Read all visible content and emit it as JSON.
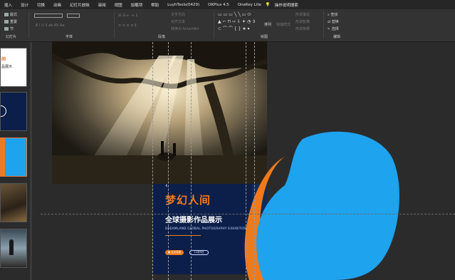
{
  "menu": [
    "插入",
    "设计",
    "切换",
    "动画",
    "幻灯片放映",
    "审阅",
    "视图",
    "加载项",
    "帮助",
    "LuyhTools(0429)",
    "OKPlus 4.5",
    "OneKey Lite",
    "操作说明搜索"
  ],
  "ribbon": {
    "slides_group": {
      "label": "幻灯片",
      "new_label": "版式",
      "reset_label": "重置",
      "section_label": "节"
    },
    "font_group": {
      "label": "字体"
    },
    "paragraph_group": {
      "label": "段落",
      "items": [
        "文字方向",
        "对齐文本",
        "转换为 SmartArt"
      ]
    },
    "drawing_group": {
      "label": "绘图",
      "arrange_label": "排列",
      "quick_styles_label": "快速样式",
      "fill_label": "形状填充",
      "outline_label": "形状轮廓",
      "effect_label": "形状效果"
    },
    "editing_group": {
      "label": "编辑",
      "find_label": "查找",
      "replace_label": "替换",
      "select_label": "选择"
    }
  },
  "slides_panel": {
    "partial_text_1": "间",
    "partial_text_2": "品展示"
  },
  "slide": {
    "title": "梦幻人间",
    "subtitle": "全球摄影作品展示",
    "subtitle_en": "DREAMLAND  GLOBAL PHOTOGRAPHY EXHIBITION",
    "pill_left": "● 点击查看",
    "pill_right": "11月9日",
    "partial_arrow": "‹"
  },
  "colors": {
    "accent": "#f07a1a",
    "blob": "#1ea3ee",
    "slide_bg": "#0c1f4a",
    "app_bg": "#2b2b2b"
  }
}
